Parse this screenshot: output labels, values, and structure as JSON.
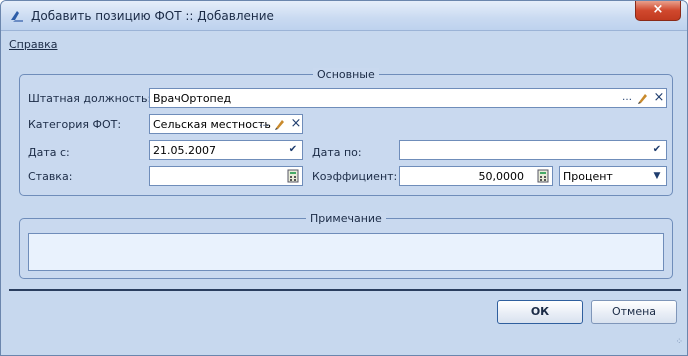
{
  "window": {
    "title": "Добавить позицию ФОТ :: Добавление",
    "close_label": "×"
  },
  "menu": {
    "help": "Справка"
  },
  "main_group": {
    "title": "Основные",
    "position_label": "Штатная должность:",
    "position_value": "ВрачОртопед",
    "category_label": "Категория ФОТ:",
    "category_value": "Сельская местность",
    "date_from_label": "Дата с:",
    "date_from_value": "21.05.2007",
    "date_to_label": "Дата по:",
    "date_to_value": "",
    "rate_label": "Ставка:",
    "rate_value": "",
    "coef_label": "Коэффициент:",
    "coef_value": "50,0000",
    "unit_value": "Процент"
  },
  "note_group": {
    "title": "Примечание",
    "value": ""
  },
  "buttons": {
    "ok": "ОК",
    "cancel": "Отмена"
  },
  "icons": {
    "ellipsis": "…",
    "clear": "×",
    "dropdown": "▼",
    "checkmark": "✔"
  }
}
